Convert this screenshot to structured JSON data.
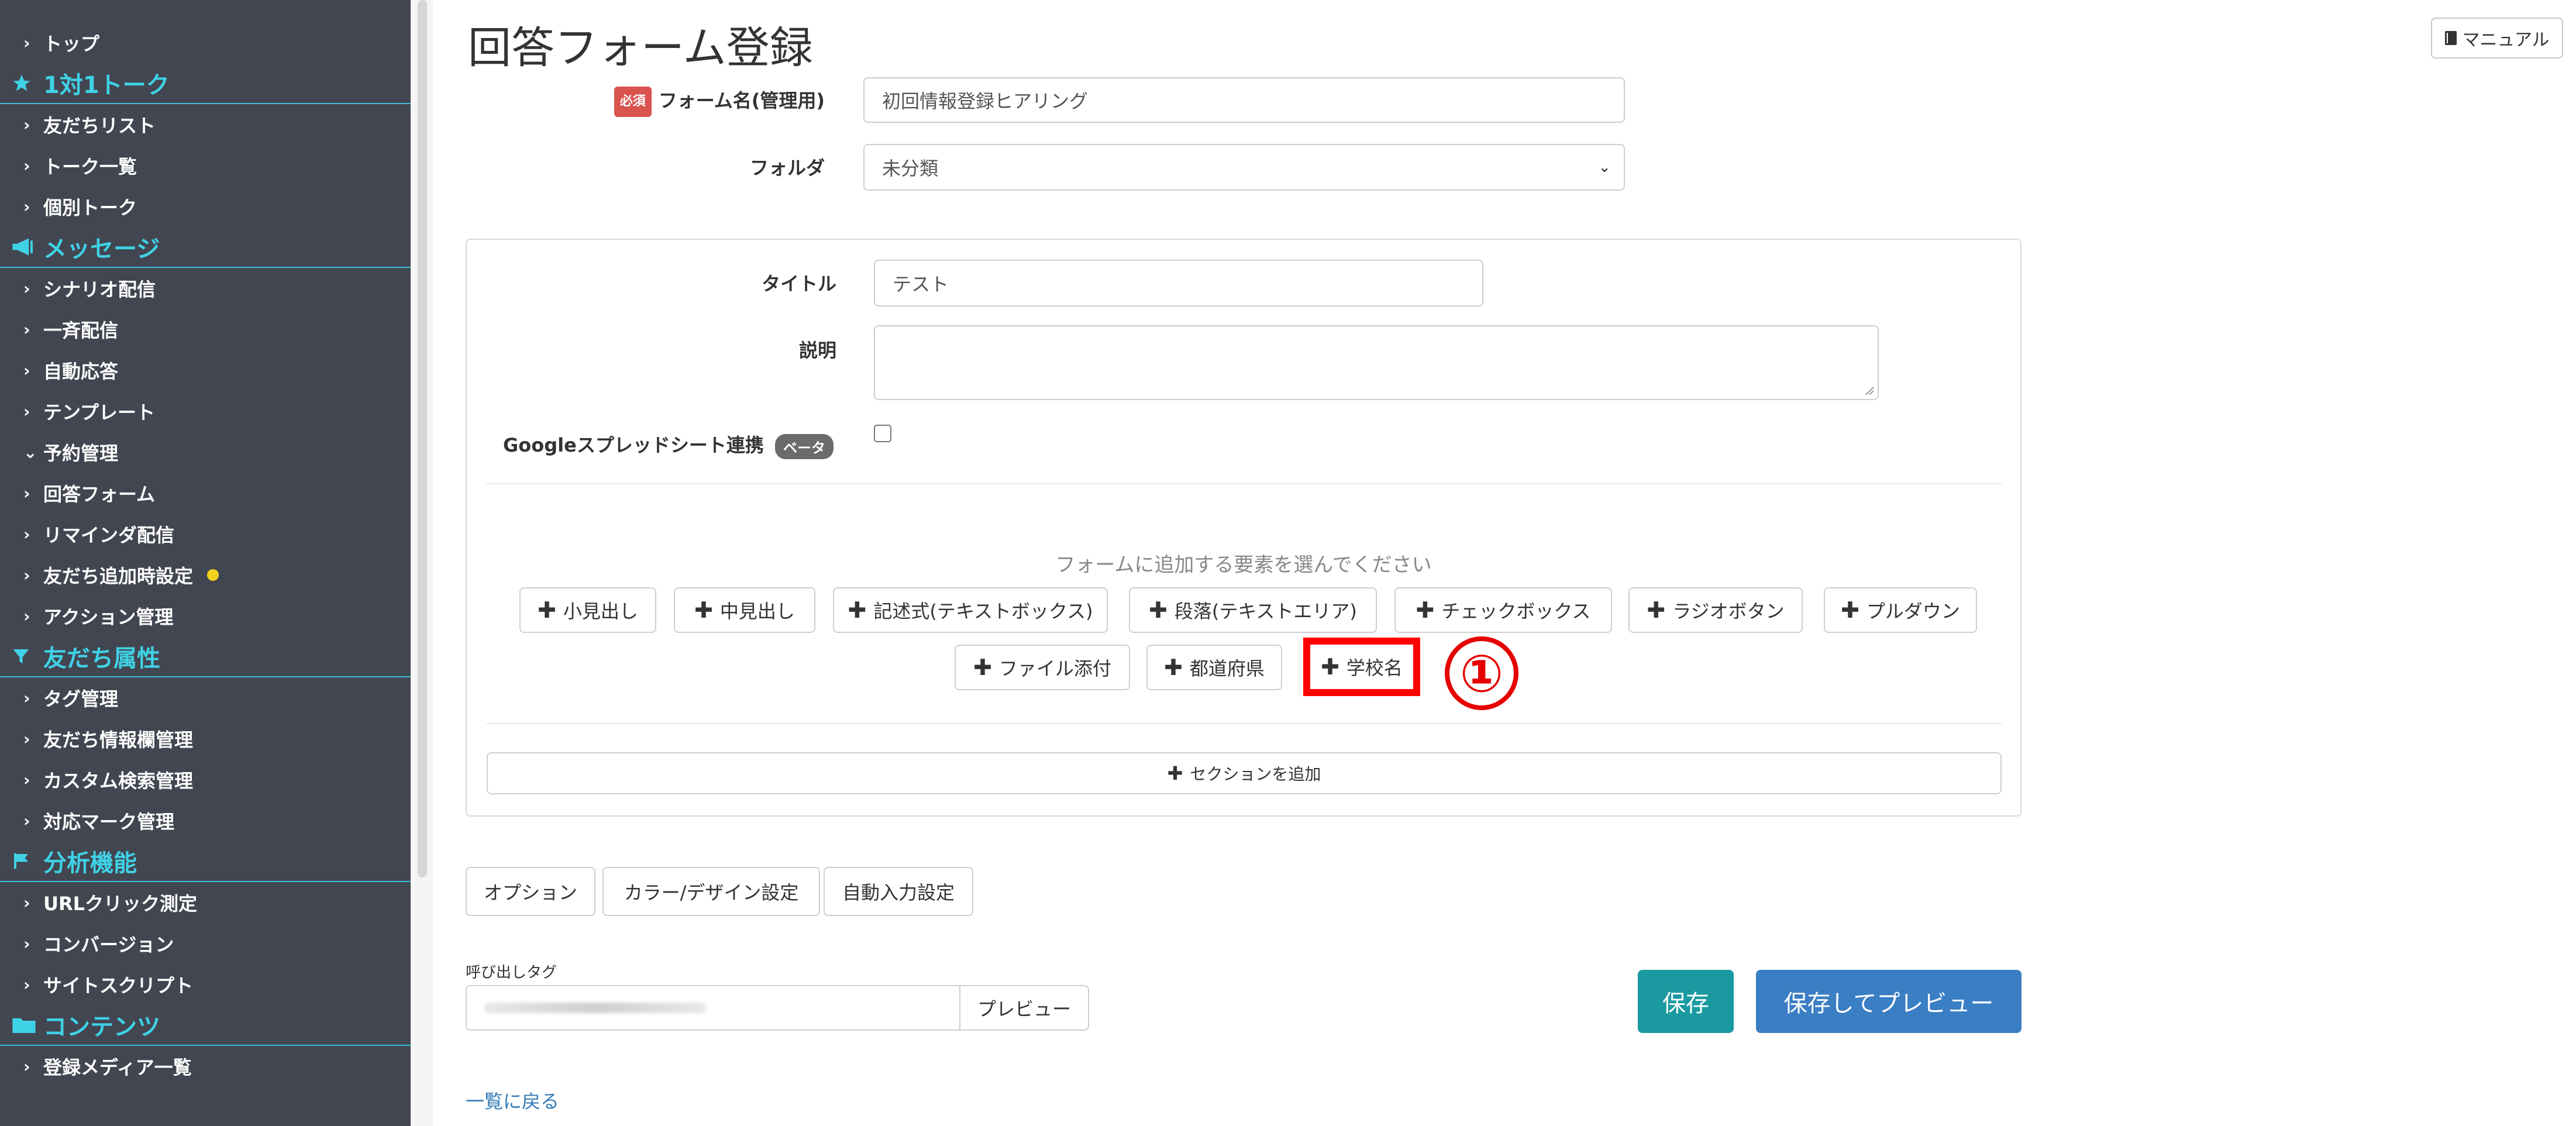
{
  "sidebar": {
    "sections": [
      {
        "type": "item",
        "label": "トップ",
        "chev": "›"
      },
      {
        "type": "section",
        "label": "1対1トーク",
        "icon": "star-icon"
      },
      {
        "type": "item",
        "label": "友だちリスト",
        "chev": "›"
      },
      {
        "type": "item",
        "label": "トーク一覧",
        "chev": "›"
      },
      {
        "type": "item",
        "label": "個別トーク",
        "chev": "›"
      },
      {
        "type": "section",
        "label": "メッセージ",
        "icon": "megaphone-icon"
      },
      {
        "type": "item",
        "label": "シナリオ配信",
        "chev": "›"
      },
      {
        "type": "item",
        "label": "一斉配信",
        "chev": "›"
      },
      {
        "type": "item",
        "label": "自動応答",
        "chev": "›"
      },
      {
        "type": "item",
        "label": "テンプレート",
        "chev": "›"
      },
      {
        "type": "item",
        "label": "予約管理",
        "chev": "⌄"
      },
      {
        "type": "item",
        "label": "回答フォーム",
        "chev": "›"
      },
      {
        "type": "item",
        "label": "リマインダ配信",
        "chev": "›"
      },
      {
        "type": "item",
        "label": "友だち追加時設定",
        "chev": "›",
        "dot": true
      },
      {
        "type": "item",
        "label": "アクション管理",
        "chev": "›"
      },
      {
        "type": "section",
        "label": "友だち属性",
        "icon": "filter-icon"
      },
      {
        "type": "item",
        "label": "タグ管理",
        "chev": "›"
      },
      {
        "type": "item",
        "label": "友だち情報欄管理",
        "chev": "›"
      },
      {
        "type": "item",
        "label": "カスタム検索管理",
        "chev": "›"
      },
      {
        "type": "item",
        "label": "対応マーク管理",
        "chev": "›"
      },
      {
        "type": "section",
        "label": "分析機能",
        "icon": "flag-icon"
      },
      {
        "type": "item",
        "label": "URLクリック測定",
        "chev": "›"
      },
      {
        "type": "item",
        "label": "コンバージョン",
        "chev": "›"
      },
      {
        "type": "item",
        "label": "サイトスクリプト",
        "chev": "›"
      },
      {
        "type": "section",
        "label": "コンテンツ",
        "icon": "folder-icon"
      },
      {
        "type": "item",
        "label": "登録メディア一覧",
        "chev": "›"
      }
    ],
    "dot_color": "#f0d21c",
    "accent": "#3fd2e6"
  },
  "header": {
    "title": "回答フォーム登録",
    "manual_label": "マニュアル"
  },
  "form": {
    "required_badge": "必須",
    "form_name_label": "フォーム名(管理用)",
    "form_name_value": "初回情報登録ヒアリング",
    "folder_label": "フォルダ",
    "folder_value": "未分類"
  },
  "panel": {
    "title_label": "タイトル",
    "title_value": "テスト",
    "description_label": "説明",
    "description_value": "",
    "gsheet_label": "Googleスプレッドシート連携",
    "beta_badge": "ベータ",
    "gsheet_checked": false,
    "add_prompt": "フォームに追加する要素を選んでください",
    "add_buttons_row1": [
      "小見出し",
      "中見出し",
      "記述式(テキストボックス)",
      "段落(テキストエリア)",
      "チェックボックス",
      "ラジオボタン",
      "プルダウン"
    ],
    "add_buttons_row2": [
      "ファイル添付",
      "都道府県",
      "学校名"
    ],
    "add_section_label": "セクションを追加",
    "annotation": "①"
  },
  "tabs": [
    "オプション",
    "カラー/デザイン設定",
    "自動入力設定"
  ],
  "call_tag": {
    "label": "呼び出しタグ",
    "preview_label": "プレビュー"
  },
  "actions": {
    "save_label": "保存",
    "save_preview_label": "保存してプレビュー",
    "save_color": "#1a9aa0",
    "save_preview_color": "#3a7ec4"
  },
  "back_link": "一覧に戻る"
}
